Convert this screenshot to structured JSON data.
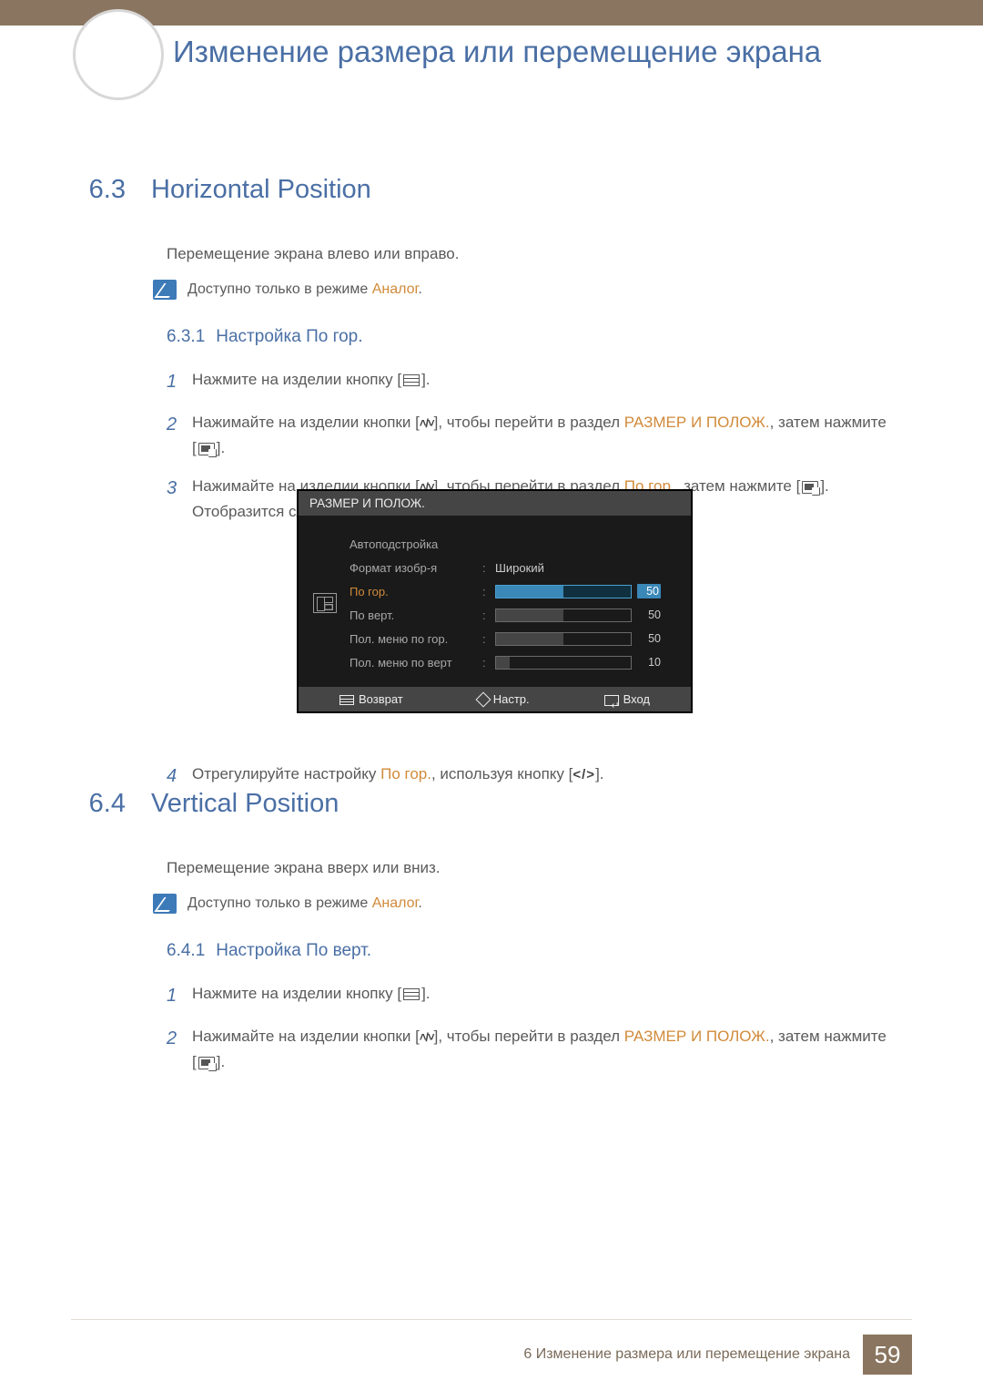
{
  "chapter": {
    "title": "Изменение размера или перемещение экрана"
  },
  "sections": {
    "s63": {
      "number": "6.3",
      "title": "Horizontal Position",
      "intro": "Перемещение экрана влево или вправо.",
      "note_prefix": "Доступно только в режиме ",
      "note_accent": "Аналог",
      "note_suffix": ".",
      "sub": {
        "number": "6.3.1",
        "title": "Настройка По гор."
      },
      "steps": {
        "s1": {
          "num": "1",
          "t1": "Нажмите на изделии кнопку [",
          "t2": "]."
        },
        "s2": {
          "num": "2",
          "t1": "Нажимайте на изделии кнопки [",
          "t2": "], чтобы перейти в раздел ",
          "accent": "РАЗМЕР И ПОЛОЖ.",
          "t3": ", затем нажмите [",
          "t4": "]."
        },
        "s3": {
          "num": "3",
          "t1": "Нажимайте на изделии кнопки [",
          "t2": "], чтобы перейти в раздел ",
          "accent": "По гор.",
          "t3": ", затем нажмите [",
          "t4": "]. Отобразится следующий экран."
        },
        "s4": {
          "num": "4",
          "t1": "Отрегулируйте настройку ",
          "accent": "По гор.",
          "t2": ", используя кнопку [",
          "t3": "]."
        }
      }
    },
    "s64": {
      "number": "6.4",
      "title": "Vertical Position",
      "intro": "Перемещение экрана вверх или вниз.",
      "note_prefix": "Доступно только в режиме ",
      "note_accent": "Аналог",
      "note_suffix": ".",
      "sub": {
        "number": "6.4.1",
        "title": "Настройка По верт."
      },
      "steps": {
        "s1": {
          "num": "1",
          "t1": "Нажмите на изделии кнопку [",
          "t2": "]."
        },
        "s2": {
          "num": "2",
          "t1": "Нажимайте на изделии кнопки [",
          "t2": "], чтобы перейти в раздел ",
          "accent": "РАЗМЕР И ПОЛОЖ.",
          "t3": ", затем нажмите [",
          "t4": "]."
        }
      }
    }
  },
  "osd": {
    "title": "РАЗМЕР И ПОЛОЖ.",
    "rows": {
      "r0": {
        "label": "Автоподстройка"
      },
      "r1": {
        "label": "Формат изобр-я",
        "value_text": "Широкий"
      },
      "r2": {
        "label": "По гор.",
        "value": "50",
        "pct": 50,
        "active": true
      },
      "r3": {
        "label": "По верт.",
        "value": "50",
        "pct": 50
      },
      "r4": {
        "label": "Пол. меню по гор.",
        "value": "50",
        "pct": 50
      },
      "r5": {
        "label": "Пол. меню по верт",
        "value": "10",
        "pct": 10
      }
    },
    "footer": {
      "back": "Возврат",
      "adjust": "Настр.",
      "enter": "Вход"
    }
  },
  "footer": {
    "chapter_line": "6 Изменение размера или перемещение экрана",
    "page": "59"
  }
}
